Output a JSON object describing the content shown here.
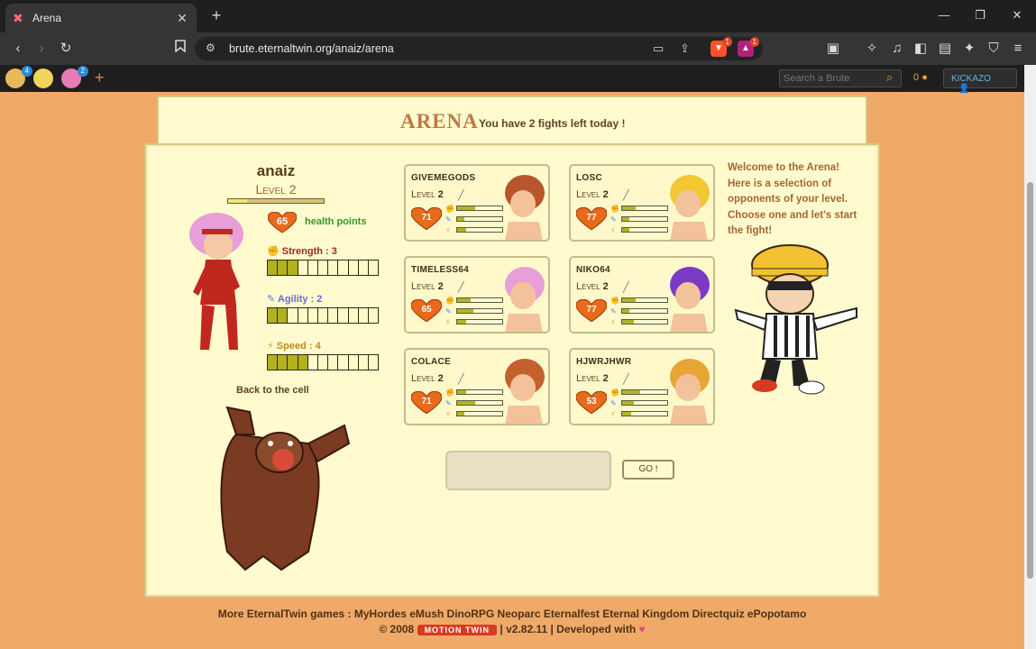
{
  "browser": {
    "tab_title": "Arena",
    "url": "brute.eternaltwin.org/anaiz/arena",
    "shield_badge": "1",
    "alert_badge": "1"
  },
  "site_header": {
    "brute_badges": [
      "4",
      "2"
    ],
    "search_placeholder": "Search a Brute",
    "gold": "0",
    "user": "KICKAZO"
  },
  "arena": {
    "title": "ARENA",
    "subtitle": "You have 2 fights left today !",
    "welcome": "Welcome to the Arena! Here is a selection of opponents of your level. Choose one and let's start the fight!",
    "go_label": "GO !",
    "back_label": "Back to the cell"
  },
  "player": {
    "name": "anaiz",
    "level": "Level 2",
    "xp_fraction": 0.2,
    "hp": "65",
    "hp_label": "health points",
    "stats": [
      {
        "label": "Strength : 3",
        "value": 3,
        "color": "#a8251c"
      },
      {
        "label": "Agility : 2",
        "value": 2,
        "color": "#6b6bd9"
      },
      {
        "label": "Speed : 4",
        "value": 4,
        "color": "#c08a1c"
      }
    ],
    "stat_max": 11
  },
  "opponents": [
    {
      "name": "GIVEMEGODS",
      "level": "2",
      "hp": "71",
      "str": 0.4,
      "agi": 0.15,
      "spd": 0.2,
      "hair": "#b8552a"
    },
    {
      "name": "LOSC",
      "level": "2",
      "hp": "77",
      "str": 0.3,
      "agi": 0.15,
      "spd": 0.15,
      "hair": "#f2c832"
    },
    {
      "name": "TIMELESS64",
      "level": "2",
      "hp": "65",
      "str": 0.3,
      "agi": 0.35,
      "spd": 0.2,
      "hair": "#e89ed6"
    },
    {
      "name": "NIKO64",
      "level": "2",
      "hp": "77",
      "str": 0.3,
      "agi": 0.15,
      "spd": 0.25,
      "hair": "#7b3ac6"
    },
    {
      "name": "COLACE",
      "level": "2",
      "hp": "71",
      "str": 0.2,
      "agi": 0.4,
      "spd": 0.15,
      "hair": "#c2602e"
    },
    {
      "name": "HJWRJHWR",
      "level": "2",
      "hp": "53",
      "str": 0.4,
      "agi": 0.25,
      "spd": 0.2,
      "hair": "#e8a535"
    }
  ],
  "footer": {
    "games_text": "More EternalTwin games : MyHordes eMush DinoRPG Neoparc Eternalfest Eternal Kingdom Directquiz ePopotamo",
    "copyright": "© 2008",
    "logo_text": "MOTION TWIN",
    "version_text": "| v2.82.11 | Developed with"
  }
}
